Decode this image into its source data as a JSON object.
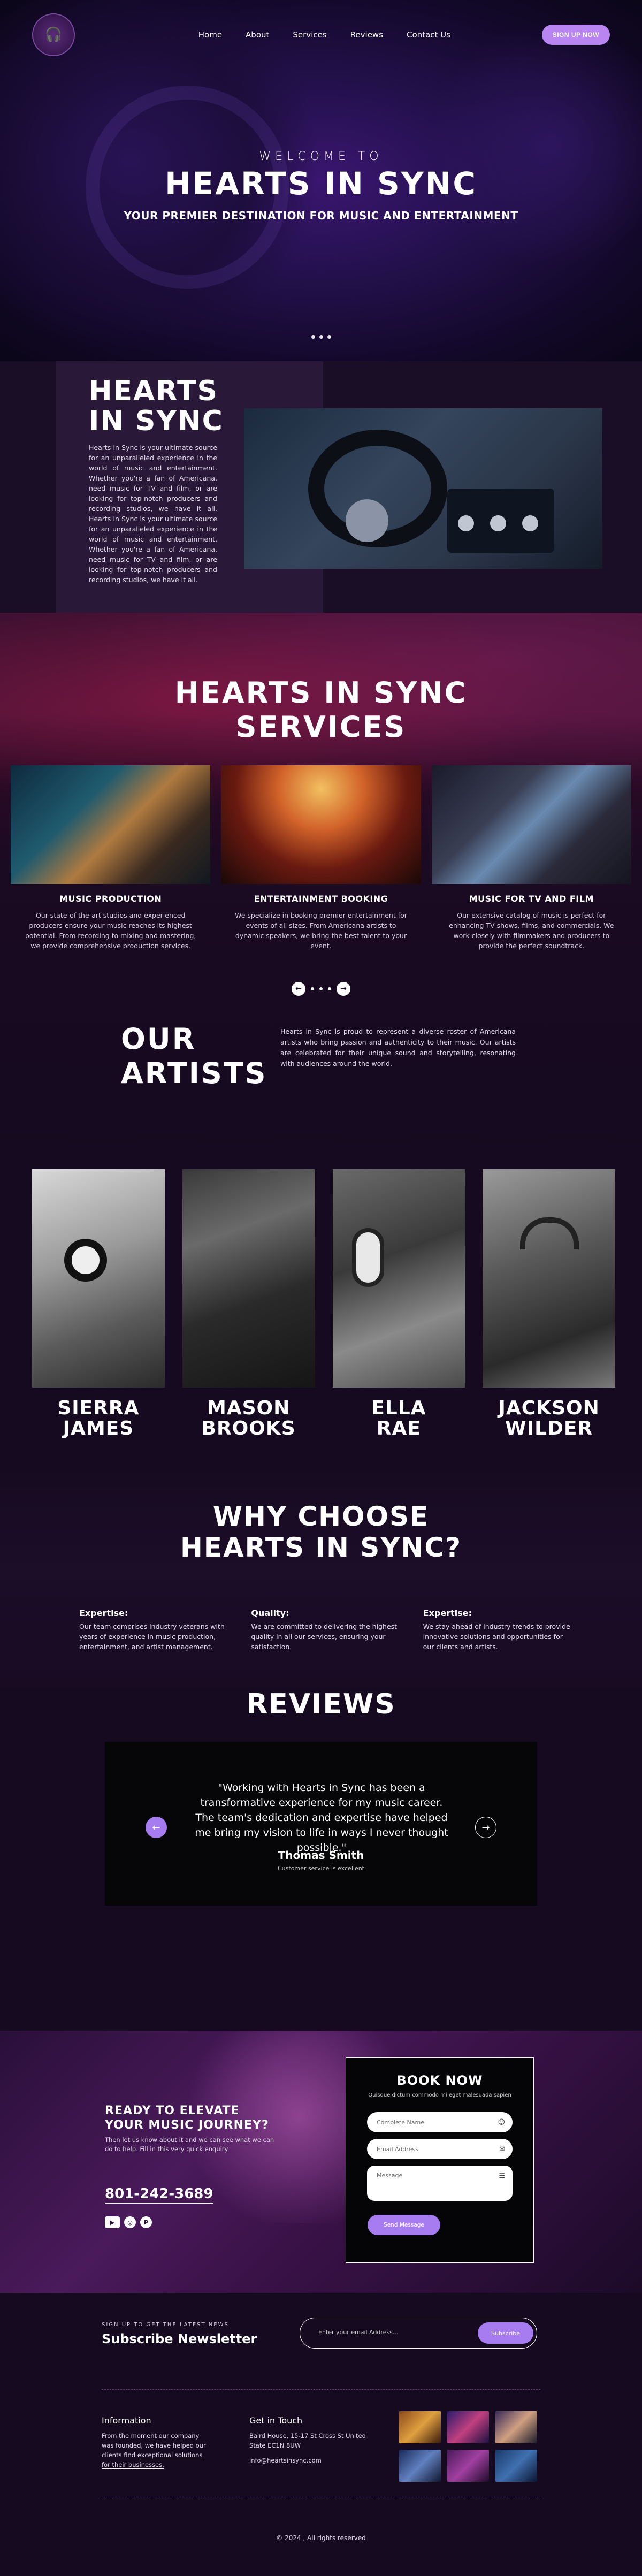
{
  "nav": {
    "logo_icon": "headphones-logo-icon",
    "items": [
      "Home",
      "About",
      "Services",
      "Reviews",
      "Contact Us"
    ],
    "signup_label": "SIGN UP NOW"
  },
  "hero": {
    "welcome": "WELCOME TO",
    "title": "HEARTS IN SYNC",
    "subtitle": "YOUR PREMIER DESTINATION FOR MUSIC AND ENTERTAINMENT"
  },
  "about": {
    "title_line1": "HEARTS",
    "title_line2": "IN SYNC",
    "body": "Hearts in Sync is your ultimate source for an unparalleled experience in the world of music and entertainment. Whether you're a fan of Americana, need music for TV and film, or are looking for top-notch producers and recording studios, we have it all. Hearts in Sync is your ultimate source for an unparalleled experience in the world of music and entertainment. Whether you're a fan of Americana, need music for TV and film, or are looking for top-notch producers and recording studios, we have it all."
  },
  "services": {
    "title_line1": "HEARTS IN SYNC",
    "title_line2": "SERVICES",
    "items": [
      {
        "title": "MUSIC PRODUCTION",
        "desc": "Our state-of-the-art studios and experienced producers ensure your music reaches its highest potential. From recording to mixing and mastering, we provide comprehensive production services."
      },
      {
        "title": "ENTERTAINMENT BOOKING",
        "desc": "We specialize in booking premier entertainment for events of all sizes. From Americana artists to dynamic speakers, we bring the best talent to your event."
      },
      {
        "title": "MUSIC FOR TV AND FILM",
        "desc": "Our extensive catalog of music is perfect for enhancing TV shows, films, and commercials. We work closely with filmmakers and producers to provide the perfect soundtrack."
      }
    ]
  },
  "artists": {
    "title_line1": "OUR",
    "title_line2": "ARTISTS",
    "intro": "Hearts in Sync is proud to represent a diverse roster of Americana artists who bring passion and authenticity to their music. Our artists are celebrated for their unique sound and storytelling, resonating with audiences around the world.",
    "people": [
      {
        "first": "SIERRA",
        "last": "JAMES"
      },
      {
        "first": "MASON",
        "last": "BROOKS"
      },
      {
        "first": "ELLA",
        "last": "RAE"
      },
      {
        "first": "JACKSON",
        "last": "WILDER"
      }
    ]
  },
  "why": {
    "title_line1": "WHY CHOOSE",
    "title_line2": "HEARTS IN SYNC?",
    "items": [
      {
        "title": "Expertise:",
        "desc": "Our team comprises industry veterans with years of experience in music production, entertainment, and artist management."
      },
      {
        "title": "Quality:",
        "desc": "We are committed to delivering the highest quality in all our services, ensuring your satisfaction."
      },
      {
        "title": "Expertise:",
        "desc": "We stay ahead of industry trends to provide innovative solutions and opportunities for our clients and artists."
      }
    ]
  },
  "reviews": {
    "title": "REVIEWS",
    "quote": "\"Working with Hearts in Sync has been a transformative experience for my music career. The team's dedication and expertise have helped me bring my vision to life in ways I never thought possible.\"",
    "author": "Thomas Smith",
    "role": "Customer service is excellent"
  },
  "book": {
    "cta_line1": "READY TO ELEVATE",
    "cta_line2": "YOUR MUSIC JOURNEY?",
    "cta_desc": "Then let us know about it and we can see what we can do to help. Fill in this very quick enquiry.",
    "phone": "801-242-3689",
    "form_title": "BOOK NOW",
    "form_desc": "Quisque dictum commodo mi eget malesuada sapien",
    "name_placeholder": "Complete Name",
    "email_placeholder": "Email Address",
    "message_placeholder": "Message",
    "send_label": "Send Message"
  },
  "newsletter": {
    "small": "SIGN UP TO GET THE LATEST NEWS",
    "title": "Subscribe Newsletter",
    "placeholder": "Enter your email Address...",
    "button": "Subscribe"
  },
  "footer": {
    "info_title": "Information",
    "info_desc_1": "From the moment our company was founded, we have helped our clients find ",
    "info_desc_link": "exceptional solutions for their businesses.",
    "contact_title": "Get in Touch",
    "address": "Baird House, 15-17 St Cross St United State EC1N 8UW",
    "email": "info@heartsinsync.com",
    "copyright": "© 2024 , All rights reserved"
  },
  "colors": {
    "accent": "#a67cf0",
    "background": "#150a1f"
  }
}
